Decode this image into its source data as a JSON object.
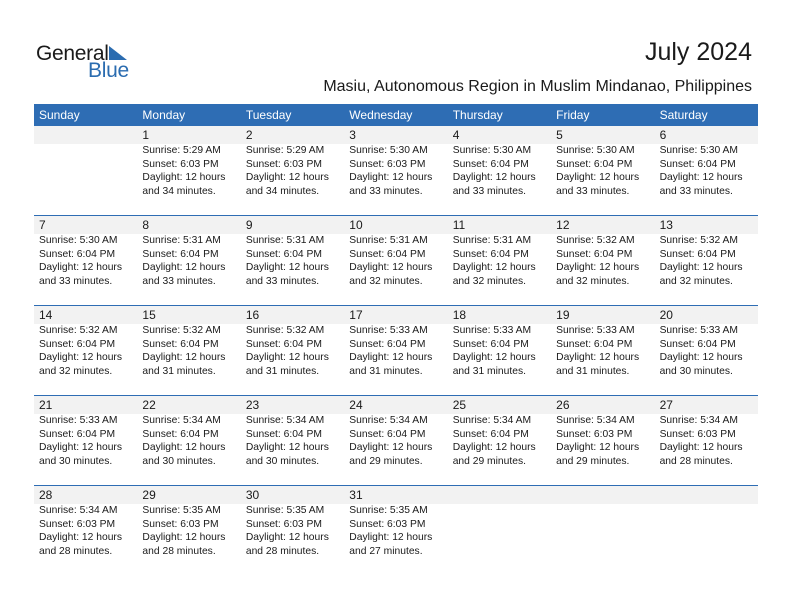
{
  "logo": {
    "line1": "General",
    "line2": "Blue"
  },
  "header": {
    "title": "July 2024",
    "subtitle": "Masiu, Autonomous Region in Muslim Mindanao, Philippines"
  },
  "colors": {
    "accent": "#2e6db4",
    "daynum_bg": "#f2f2f2"
  },
  "weekdays": [
    "Sunday",
    "Monday",
    "Tuesday",
    "Wednesday",
    "Thursday",
    "Friday",
    "Saturday"
  ],
  "weeks": [
    [
      {
        "day": "",
        "sunrise": "",
        "sunset": "",
        "daylight": "",
        "minutes": ""
      },
      {
        "day": "1",
        "sunrise": "Sunrise: 5:29 AM",
        "sunset": "Sunset: 6:03 PM",
        "daylight": "Daylight: 12 hours",
        "minutes": "and 34 minutes."
      },
      {
        "day": "2",
        "sunrise": "Sunrise: 5:29 AM",
        "sunset": "Sunset: 6:03 PM",
        "daylight": "Daylight: 12 hours",
        "minutes": "and 34 minutes."
      },
      {
        "day": "3",
        "sunrise": "Sunrise: 5:30 AM",
        "sunset": "Sunset: 6:03 PM",
        "daylight": "Daylight: 12 hours",
        "minutes": "and 33 minutes."
      },
      {
        "day": "4",
        "sunrise": "Sunrise: 5:30 AM",
        "sunset": "Sunset: 6:04 PM",
        "daylight": "Daylight: 12 hours",
        "minutes": "and 33 minutes."
      },
      {
        "day": "5",
        "sunrise": "Sunrise: 5:30 AM",
        "sunset": "Sunset: 6:04 PM",
        "daylight": "Daylight: 12 hours",
        "minutes": "and 33 minutes."
      },
      {
        "day": "6",
        "sunrise": "Sunrise: 5:30 AM",
        "sunset": "Sunset: 6:04 PM",
        "daylight": "Daylight: 12 hours",
        "minutes": "and 33 minutes."
      }
    ],
    [
      {
        "day": "7",
        "sunrise": "Sunrise: 5:30 AM",
        "sunset": "Sunset: 6:04 PM",
        "daylight": "Daylight: 12 hours",
        "minutes": "and 33 minutes."
      },
      {
        "day": "8",
        "sunrise": "Sunrise: 5:31 AM",
        "sunset": "Sunset: 6:04 PM",
        "daylight": "Daylight: 12 hours",
        "minutes": "and 33 minutes."
      },
      {
        "day": "9",
        "sunrise": "Sunrise: 5:31 AM",
        "sunset": "Sunset: 6:04 PM",
        "daylight": "Daylight: 12 hours",
        "minutes": "and 33 minutes."
      },
      {
        "day": "10",
        "sunrise": "Sunrise: 5:31 AM",
        "sunset": "Sunset: 6:04 PM",
        "daylight": "Daylight: 12 hours",
        "minutes": "and 32 minutes."
      },
      {
        "day": "11",
        "sunrise": "Sunrise: 5:31 AM",
        "sunset": "Sunset: 6:04 PM",
        "daylight": "Daylight: 12 hours",
        "minutes": "and 32 minutes."
      },
      {
        "day": "12",
        "sunrise": "Sunrise: 5:32 AM",
        "sunset": "Sunset: 6:04 PM",
        "daylight": "Daylight: 12 hours",
        "minutes": "and 32 minutes."
      },
      {
        "day": "13",
        "sunrise": "Sunrise: 5:32 AM",
        "sunset": "Sunset: 6:04 PM",
        "daylight": "Daylight: 12 hours",
        "minutes": "and 32 minutes."
      }
    ],
    [
      {
        "day": "14",
        "sunrise": "Sunrise: 5:32 AM",
        "sunset": "Sunset: 6:04 PM",
        "daylight": "Daylight: 12 hours",
        "minutes": "and 32 minutes."
      },
      {
        "day": "15",
        "sunrise": "Sunrise: 5:32 AM",
        "sunset": "Sunset: 6:04 PM",
        "daylight": "Daylight: 12 hours",
        "minutes": "and 31 minutes."
      },
      {
        "day": "16",
        "sunrise": "Sunrise: 5:32 AM",
        "sunset": "Sunset: 6:04 PM",
        "daylight": "Daylight: 12 hours",
        "minutes": "and 31 minutes."
      },
      {
        "day": "17",
        "sunrise": "Sunrise: 5:33 AM",
        "sunset": "Sunset: 6:04 PM",
        "daylight": "Daylight: 12 hours",
        "minutes": "and 31 minutes."
      },
      {
        "day": "18",
        "sunrise": "Sunrise: 5:33 AM",
        "sunset": "Sunset: 6:04 PM",
        "daylight": "Daylight: 12 hours",
        "minutes": "and 31 minutes."
      },
      {
        "day": "19",
        "sunrise": "Sunrise: 5:33 AM",
        "sunset": "Sunset: 6:04 PM",
        "daylight": "Daylight: 12 hours",
        "minutes": "and 31 minutes."
      },
      {
        "day": "20",
        "sunrise": "Sunrise: 5:33 AM",
        "sunset": "Sunset: 6:04 PM",
        "daylight": "Daylight: 12 hours",
        "minutes": "and 30 minutes."
      }
    ],
    [
      {
        "day": "21",
        "sunrise": "Sunrise: 5:33 AM",
        "sunset": "Sunset: 6:04 PM",
        "daylight": "Daylight: 12 hours",
        "minutes": "and 30 minutes."
      },
      {
        "day": "22",
        "sunrise": "Sunrise: 5:34 AM",
        "sunset": "Sunset: 6:04 PM",
        "daylight": "Daylight: 12 hours",
        "minutes": "and 30 minutes."
      },
      {
        "day": "23",
        "sunrise": "Sunrise: 5:34 AM",
        "sunset": "Sunset: 6:04 PM",
        "daylight": "Daylight: 12 hours",
        "minutes": "and 30 minutes."
      },
      {
        "day": "24",
        "sunrise": "Sunrise: 5:34 AM",
        "sunset": "Sunset: 6:04 PM",
        "daylight": "Daylight: 12 hours",
        "minutes": "and 29 minutes."
      },
      {
        "day": "25",
        "sunrise": "Sunrise: 5:34 AM",
        "sunset": "Sunset: 6:04 PM",
        "daylight": "Daylight: 12 hours",
        "minutes": "and 29 minutes."
      },
      {
        "day": "26",
        "sunrise": "Sunrise: 5:34 AM",
        "sunset": "Sunset: 6:03 PM",
        "daylight": "Daylight: 12 hours",
        "minutes": "and 29 minutes."
      },
      {
        "day": "27",
        "sunrise": "Sunrise: 5:34 AM",
        "sunset": "Sunset: 6:03 PM",
        "daylight": "Daylight: 12 hours",
        "minutes": "and 28 minutes."
      }
    ],
    [
      {
        "day": "28",
        "sunrise": "Sunrise: 5:34 AM",
        "sunset": "Sunset: 6:03 PM",
        "daylight": "Daylight: 12 hours",
        "minutes": "and 28 minutes."
      },
      {
        "day": "29",
        "sunrise": "Sunrise: 5:35 AM",
        "sunset": "Sunset: 6:03 PM",
        "daylight": "Daylight: 12 hours",
        "minutes": "and 28 minutes."
      },
      {
        "day": "30",
        "sunrise": "Sunrise: 5:35 AM",
        "sunset": "Sunset: 6:03 PM",
        "daylight": "Daylight: 12 hours",
        "minutes": "and 28 minutes."
      },
      {
        "day": "31",
        "sunrise": "Sunrise: 5:35 AM",
        "sunset": "Sunset: 6:03 PM",
        "daylight": "Daylight: 12 hours",
        "minutes": "and 27 minutes."
      },
      {
        "day": "",
        "sunrise": "",
        "sunset": "",
        "daylight": "",
        "minutes": ""
      },
      {
        "day": "",
        "sunrise": "",
        "sunset": "",
        "daylight": "",
        "minutes": ""
      },
      {
        "day": "",
        "sunrise": "",
        "sunset": "",
        "daylight": "",
        "minutes": ""
      }
    ]
  ]
}
